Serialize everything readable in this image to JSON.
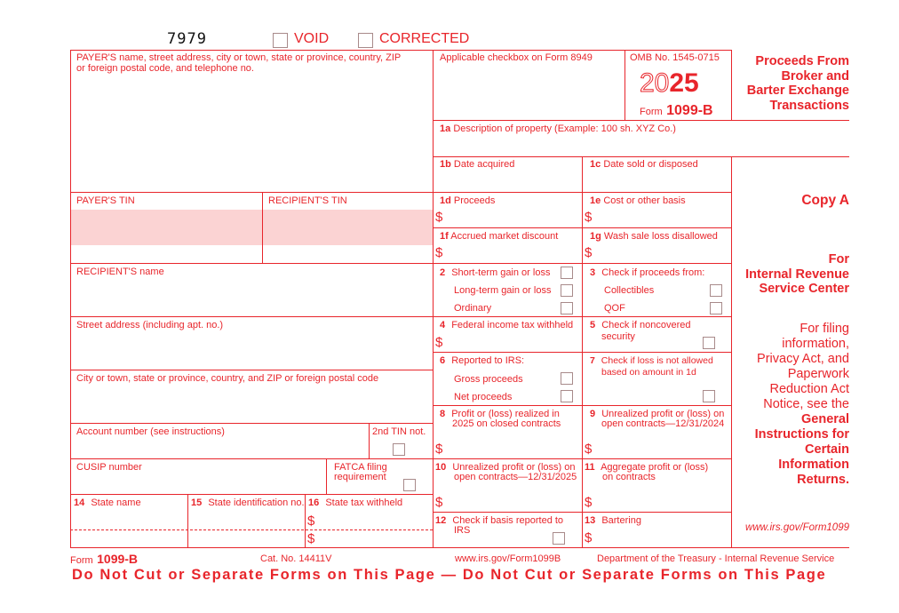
{
  "header": {
    "form_code": "7979",
    "void_label": "VOID",
    "corrected_label": "CORRECTED"
  },
  "payer": {
    "name_label_line1": "PAYER'S name, street address, city or town, state or province, country, ZIP",
    "name_label_line2": "or foreign postal code, and telephone no.",
    "tin_label": "PAYER'S TIN"
  },
  "recipient": {
    "tin_label": "RECIPIENT'S TIN",
    "name_label": "RECIPIENT'S name",
    "street_label": "Street address (including apt. no.)",
    "city_label": "City or town, state or province, country, and ZIP or foreign postal code",
    "account_label": "Account number (see instructions)",
    "second_tin_label": "2nd TIN not.",
    "cusip_label": "CUSIP number",
    "fatca_label_line1": "FATCA filing",
    "fatca_label_line2": "requirement"
  },
  "top_right": {
    "checkbox_8949_label": "Applicable checkbox on Form 8949",
    "omb": "OMB No. 1545-0715",
    "year_outline": "20",
    "year_bold": "25",
    "form_prefix": "Form",
    "form_name": "1099-B",
    "title_lines": [
      "Proceeds From",
      "Broker and",
      "Barter Exchange",
      "Transactions"
    ]
  },
  "boxes": {
    "b1a": {
      "num": "1a",
      "label": "Description of property (Example: 100 sh. XYZ Co.)"
    },
    "b1b": {
      "num": "1b",
      "label": "Date acquired"
    },
    "b1c": {
      "num": "1c",
      "label": "Date sold or disposed"
    },
    "b1d": {
      "num": "1d",
      "label": "Proceeds"
    },
    "b1e": {
      "num": "1e",
      "label": "Cost or other basis"
    },
    "b1f": {
      "num": "1f",
      "label": "Accrued market discount"
    },
    "b1g": {
      "num": "1g",
      "label": "Wash sale loss disallowed"
    },
    "b2": {
      "num": "2",
      "label": "Short-term gain or loss",
      "opt2": "Long-term gain or loss",
      "opt3": "Ordinary"
    },
    "b3": {
      "num": "3",
      "label": "Check if proceeds from:",
      "opt1": "Collectibles",
      "opt2": "QOF"
    },
    "b4": {
      "num": "4",
      "label": "Federal income tax withheld"
    },
    "b5": {
      "num": "5",
      "label_line1": "Check if noncovered",
      "label_line2": "security"
    },
    "b6": {
      "num": "6",
      "label": "Reported to IRS:",
      "opt1": "Gross proceeds",
      "opt2": "Net proceeds"
    },
    "b7": {
      "num": "7",
      "label_line1": "Check if loss is not allowed",
      "label_line2": "based on amount in 1d"
    },
    "b8": {
      "num": "8",
      "label_line1": "Profit or (loss) realized in",
      "label_line2": "2025 on closed contracts"
    },
    "b9": {
      "num": "9",
      "label_line1": "Unrealized profit or (loss) on",
      "label_line2": "open contracts—12/31/2024"
    },
    "b10": {
      "num": "10",
      "label_line1": "Unrealized profit or (loss) on",
      "label_line2": "open contracts—12/31/2025"
    },
    "b11": {
      "num": "11",
      "label_line1": "Aggregate profit or (loss)",
      "label_line2": "on contracts"
    },
    "b12": {
      "num": "12",
      "label_line1": "Check if basis reported to",
      "label_line2": "IRS"
    },
    "b13": {
      "num": "13",
      "label": "Bartering"
    },
    "b14": {
      "num": "14",
      "label": "State name"
    },
    "b15": {
      "num": "15",
      "label": "State identification no."
    },
    "b16": {
      "num": "16",
      "label": "State tax withheld"
    }
  },
  "currency_symbol": "$",
  "sidebar": {
    "copy": "Copy A",
    "for_lines": [
      "For",
      "Internal Revenue",
      "Service Center"
    ],
    "info_lines": [
      "For filing",
      "information,",
      "Privacy Act, and",
      "Paperwork",
      "Reduction Act",
      "Notice, see the"
    ],
    "info_bold_lines": [
      "General",
      "Instructions for",
      "Certain",
      "Information",
      "Returns."
    ],
    "url": "www.irs.gov/Form1099"
  },
  "footer": {
    "form_prefix": "Form",
    "form_name": "1099-B",
    "cat_no": "Cat. No. 14411V",
    "url": "www.irs.gov/Form1099B",
    "dept": "Department of the Treasury - Internal Revenue Service",
    "warning": "Do Not Cut or Separate Forms on This Page — Do Not Cut or Separate Forms on This Page"
  },
  "colors": {
    "form_red": "#e8252b",
    "tin_shade": "#fbd3d3",
    "checkbox_border": "#a88a8a"
  }
}
